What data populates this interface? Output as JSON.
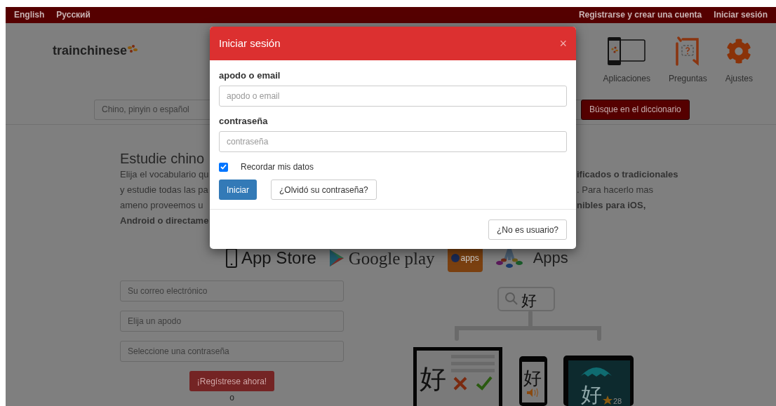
{
  "top_bar": {
    "languages": [
      "English",
      "Русский"
    ],
    "links": [
      "Registrarse y crear una cuenta",
      "Iniciar sesión"
    ]
  },
  "header": {
    "logo": "trainchinese",
    "nav": [
      {
        "kind": "apps",
        "label": "Aplicaciones"
      },
      {
        "kind": "quiz",
        "label": "Preguntas"
      },
      {
        "kind": "settings",
        "label": "Ajustes"
      }
    ],
    "search": {
      "placeholder": "Chino, pinyin o español",
      "button": "Búsque en el diccionario"
    }
  },
  "intro": {
    "title": "Estudie chino",
    "rows": [
      {
        "left": {
          "text": "Elija el vocabulario qu",
          "bold": false
        },
        "right": {
          "text": "ificados o tradicionales",
          "bold": true
        }
      },
      {
        "left": {
          "text": "y estudie todas las pa",
          "bold": false
        },
        "right": {
          "text": ". Para hacerlo mas",
          "bold": false
        }
      },
      {
        "left": {
          "text": "ameno proveemos u",
          "bold": false
        },
        "right": {
          "text": "nibles para iOS,",
          "bold": true
        }
      },
      {
        "left": {
          "text": "Android o directame",
          "bold": true
        }
      }
    ]
  },
  "stores": [
    {
      "kind": "app_store",
      "label": "App Store"
    },
    {
      "kind": "google_play",
      "label": "Google play"
    },
    {
      "kind": "apps_tile",
      "label": "apps"
    },
    {
      "kind": "samsung",
      "label": "Apps"
    }
  ],
  "signup": {
    "fields": [
      {
        "placeholder": "Su correo electrónico"
      },
      {
        "placeholder": "Elija un apodo"
      },
      {
        "placeholder": "Seleccione una contraseña"
      }
    ],
    "button": "¡Regístrese ahora!",
    "separator": "o"
  },
  "illustration": {
    "search_char": "好",
    "monitor_char": "好",
    "phone_char": "好",
    "tablet_char": "好",
    "tablet_count": "28"
  },
  "modal": {
    "title": "Iniciar sesión",
    "close": "×",
    "fields": [
      {
        "label": "apodo o email",
        "placeholder": "apodo o email"
      },
      {
        "label": "contraseña",
        "placeholder": "contraseña"
      }
    ],
    "remember": {
      "label": "Recordar mis datos",
      "checked": true
    },
    "submit": "Iniciar",
    "forgot": "¿Olvidó su contraseña?",
    "footer_button": "¿No es usuario?"
  }
}
